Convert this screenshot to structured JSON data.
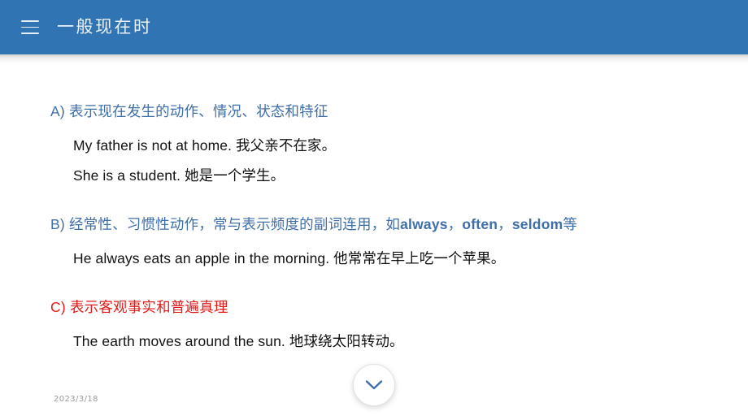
{
  "header": {
    "menu_icon": "hamburger-icon",
    "title": "一般现在时"
  },
  "slide": {
    "sections": [
      {
        "marker": "A)",
        "heading": "表示现在发生的动作、情况、状态和特征",
        "heading_color": "#3F6FA8",
        "examples": [
          "My father is not at home. 我父亲不在家。",
          "She is a student. 她是一个学生。"
        ]
      },
      {
        "marker": "B)",
        "heading_part1": "经常性、习惯性动作，常与表示频度的副词连用，如",
        "keyword1": "always",
        "sep1": "，",
        "keyword2": "often",
        "sep2": "，",
        "keyword3": "seldom",
        "heading_part2": "等",
        "heading_color": "#3F6FA8",
        "examples": [
          "He always eats an apple in the morning. 他常常在早上吃一个苹果。"
        ]
      },
      {
        "marker": "C)",
        "heading": "表示客观事实和普遍真理",
        "heading_color": "#E01B18",
        "examples": [
          "The earth moves around the sun. 地球绕太阳转动。"
        ]
      }
    ]
  },
  "footer": {
    "date": "2023/3/18",
    "next_icon": "chevron-down-icon"
  },
  "colors": {
    "header_blue": "#3174B4",
    "heading_blue": "#3F6FA8",
    "heading_red": "#E01B18",
    "chevron_blue": "#3F6FA8",
    "body_text": "#111111",
    "date_gray": "#9a9a9a"
  }
}
